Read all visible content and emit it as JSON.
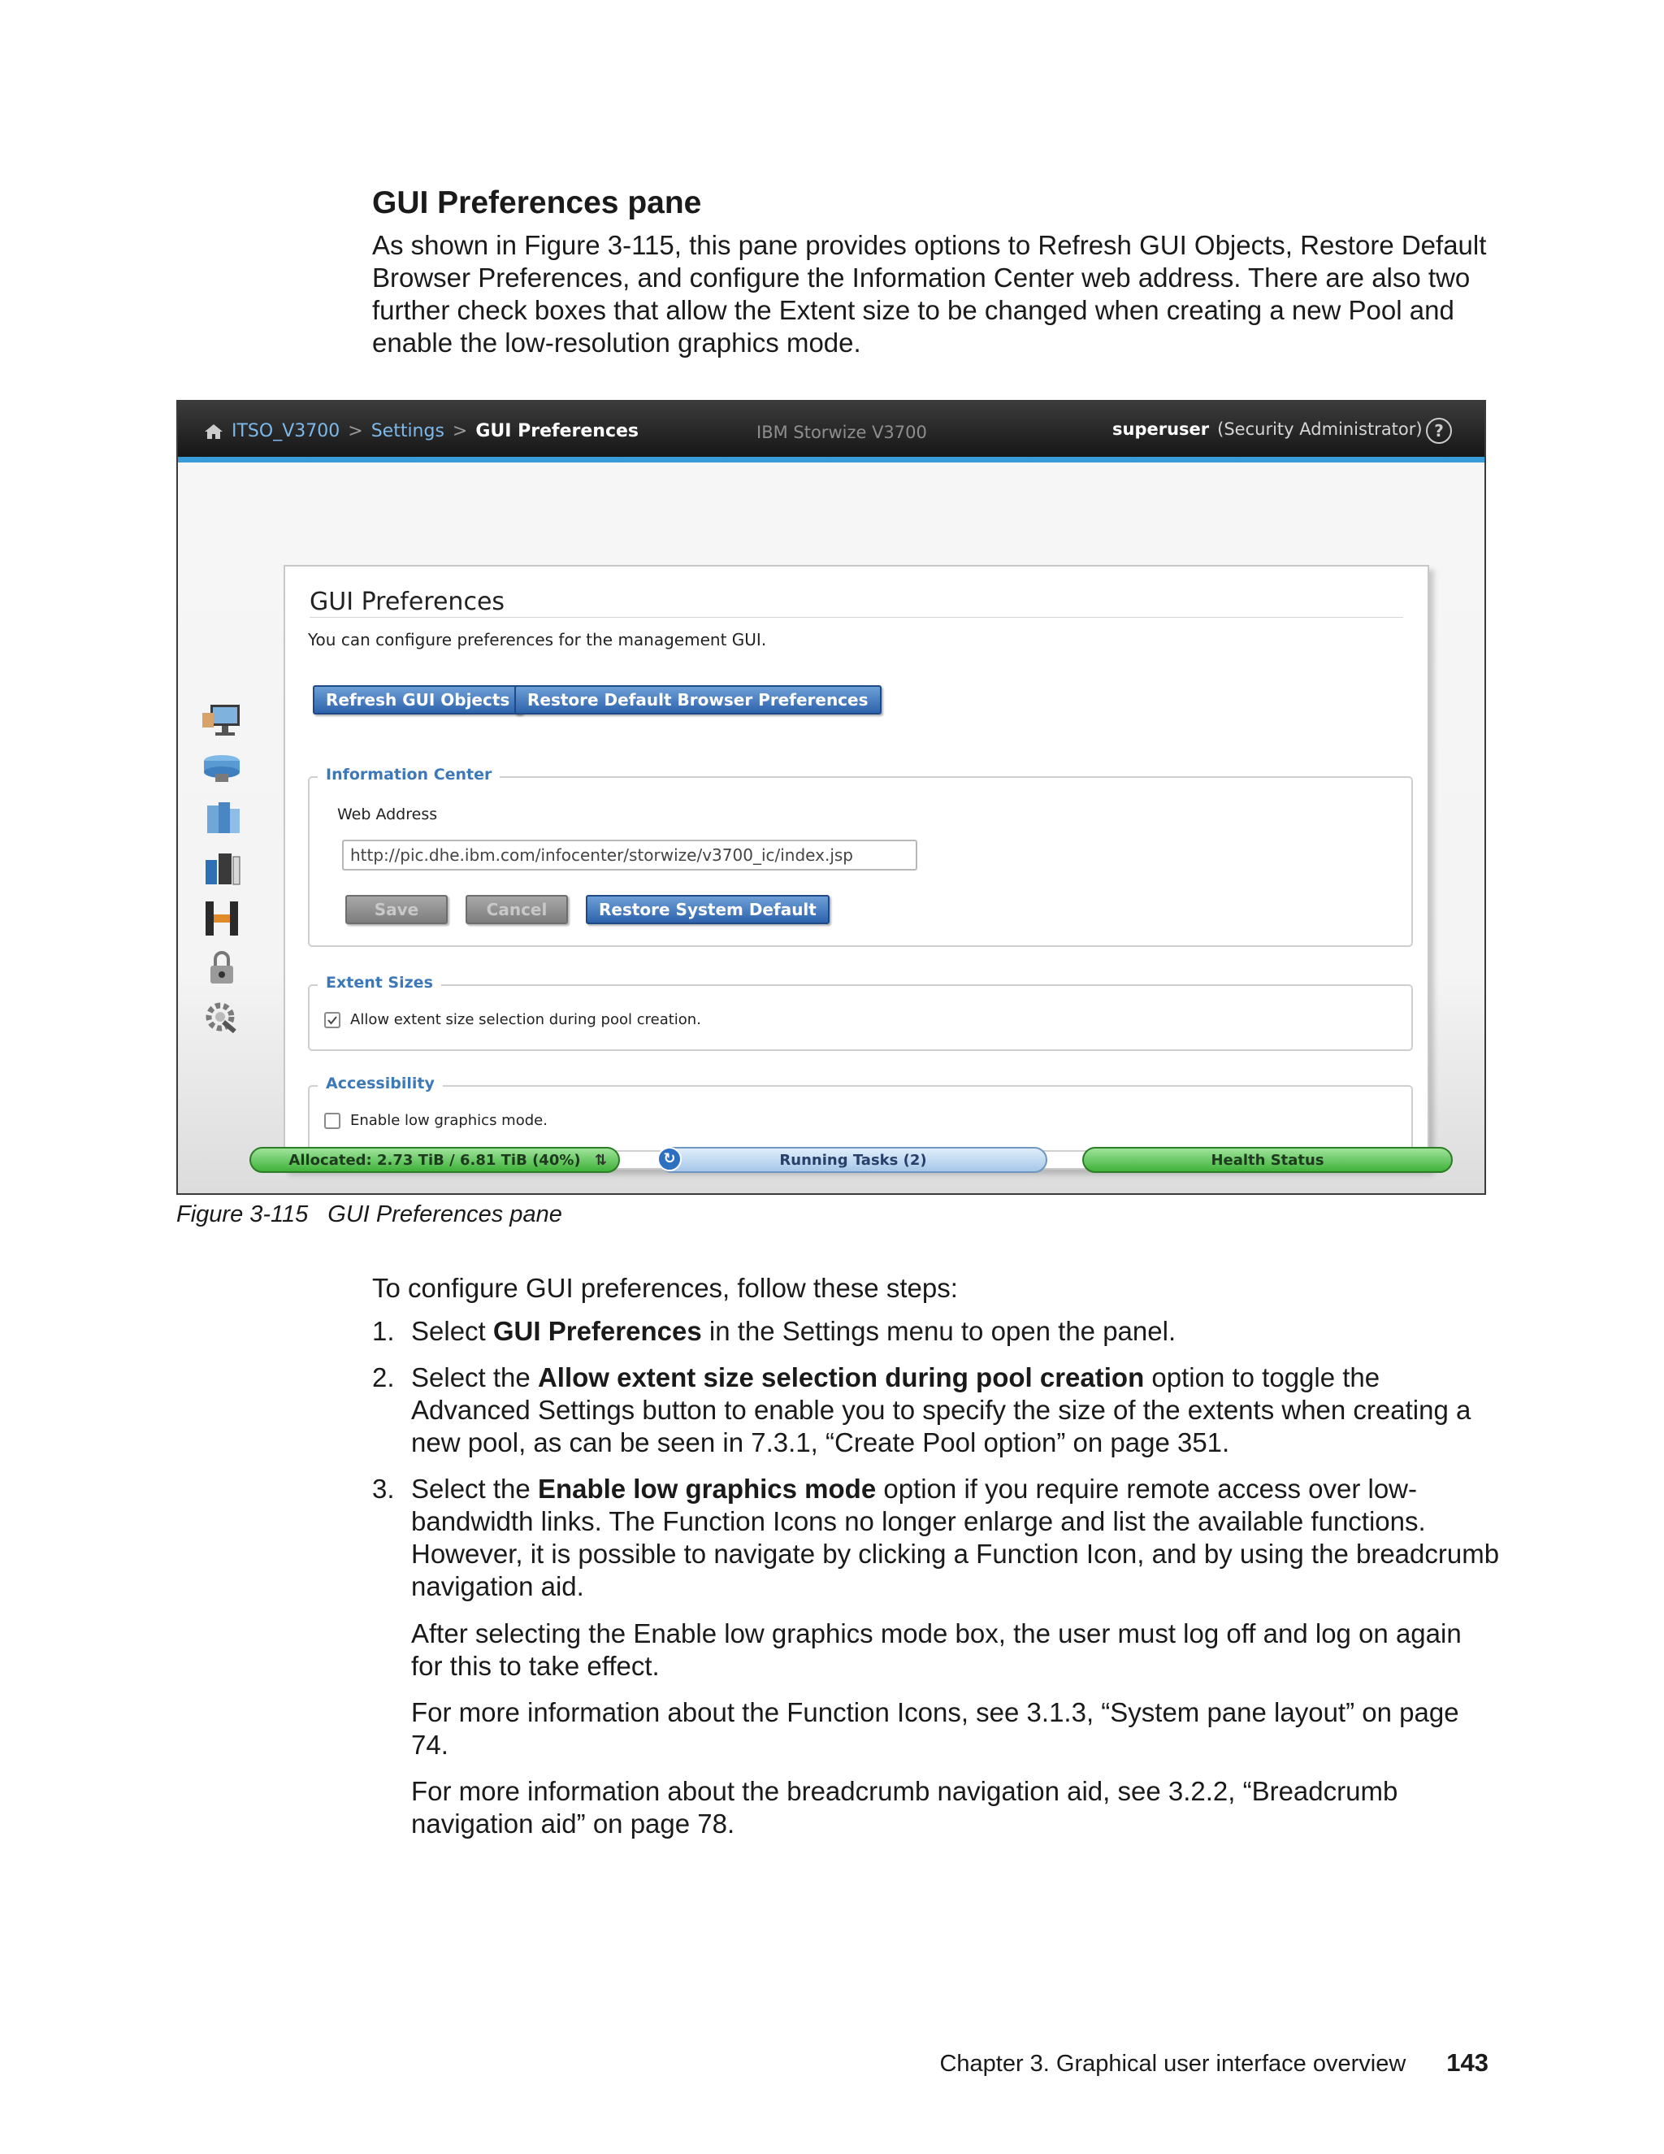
{
  "section": {
    "title": "GUI Preferences pane",
    "intro": "As shown in Figure 3-115, this pane provides options to Refresh GUI Objects, Restore Default Browser Preferences, and configure the Information Center web address. There are also two further check boxes that allow the Extent size to be changed when creating a new Pool and enable the low-resolution graphics mode."
  },
  "screenshot": {
    "breadcrumb": [
      "ITSO_V3700",
      "Settings",
      "GUI Preferences"
    ],
    "breadcrumb_separator": ">",
    "product_name": "IBM Storwize V3700",
    "user": "superuser",
    "role": "(Security Administrator)",
    "help_symbol": "?",
    "side_icons": [
      "monitoring-icon",
      "pools-icon",
      "volumes-icon",
      "hosts-icon",
      "copy-services-icon",
      "access-icon",
      "settings-icon"
    ],
    "panel": {
      "title": "GUI Preferences",
      "description": "You can configure preferences for the management GUI.",
      "refresh_button": "Refresh GUI Objects",
      "restore_browser_button": "Restore Default Browser Preferences",
      "info_center": {
        "legend": "Information Center",
        "label": "Web Address",
        "value": "http://pic.dhe.ibm.com/infocenter/storwize/v3700_ic/index.jsp",
        "save_button": "Save",
        "cancel_button": "Cancel",
        "restore_button": "Restore System Default"
      },
      "extent_sizes": {
        "legend": "Extent Sizes",
        "checkbox_label": "Allow extent size selection during pool creation.",
        "checked": true
      },
      "accessibility": {
        "legend": "Accessibility",
        "checkbox_label": "Enable low graphics mode.",
        "checked": false
      }
    },
    "status_bar": {
      "allocated": "Allocated: 2.73 TiB / 6.81 TiB (40%)",
      "allocated_fraction": 0.4,
      "running_tasks": "Running Tasks (2)",
      "health_status": "Health Status"
    }
  },
  "figure": {
    "label": "Figure 3-115",
    "caption": "GUI Preferences pane"
  },
  "steps": {
    "intro": "To configure GUI preferences, follow these steps:",
    "items": [
      {
        "num": "1.",
        "pre": "Select ",
        "bold": "GUI Preferences",
        "post": " in the Settings menu to open the panel."
      },
      {
        "num": "2.",
        "pre": "Select the ",
        "bold": "Allow extent size selection during pool creation",
        "post": " option to toggle the Advanced Settings button to enable you to specify the size of the extents when creating a new pool, as can be seen in 7.3.1, “Create Pool option” on page 351."
      },
      {
        "num": "3.",
        "pre": "Select the ",
        "bold": "Enable low graphics mode",
        "post": " option if you require remote access over low-bandwidth links. The Function Icons no longer enlarge and list the available functions. However, it is possible to navigate by clicking a Function Icon, and by using the breadcrumb navigation aid."
      }
    ],
    "paragraphs": [
      "After selecting the Enable low graphics mode box, the user must log off and log on again for this to take effect.",
      "For more information about the Function Icons, see 3.1.3, “System pane layout” on page 74.",
      "For more information about the breadcrumb navigation aid, see 3.2.2, “Breadcrumb navigation aid” on page 78."
    ]
  },
  "footer": {
    "chapter": "Chapter 3. Graphical user interface overview",
    "page": "143"
  },
  "colors": {
    "topbar": "#1e1e1e",
    "accent": "#3a9bd9",
    "link": "#7db8ea",
    "button_blue": "#2e63ad",
    "legend": "#3d78b8",
    "status_green": "#3fb23a"
  }
}
